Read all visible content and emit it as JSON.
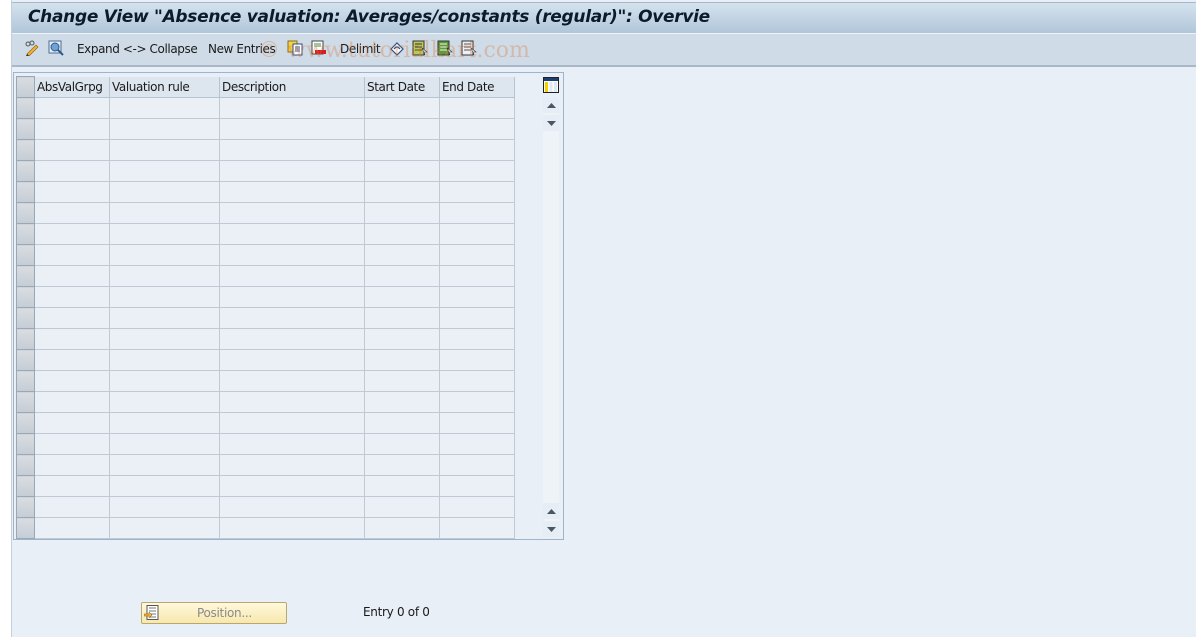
{
  "window": {
    "title": "Change View \"Absence valuation: Averages/constants (regular)\": Overvie"
  },
  "toolbar": {
    "items": [
      {
        "type": "icon",
        "icon": "display-change-icon"
      },
      {
        "type": "icon",
        "icon": "details-icon"
      },
      {
        "type": "text",
        "label": "Expand <-> Collapse"
      },
      {
        "type": "text",
        "label": "New Entries"
      },
      {
        "type": "icon",
        "icon": "copy-as-icon"
      },
      {
        "type": "icon",
        "icon": "delete-icon"
      },
      {
        "type": "text",
        "label": "Delimit"
      },
      {
        "type": "icon",
        "icon": "undo-change-icon"
      },
      {
        "type": "icon",
        "icon": "select-all-icon"
      },
      {
        "type": "icon",
        "icon": "select-block-icon"
      },
      {
        "type": "icon",
        "icon": "deselect-all-icon"
      }
    ],
    "expand_collapse_label": "Expand <-> Collapse",
    "new_entries_label": "New Entries",
    "delimit_label": "Delimit"
  },
  "watermark": "© www.tutorialkart.com",
  "table": {
    "columns": [
      "AbsValGrpg",
      "Valuation rule",
      "Description",
      "Start Date",
      "End Date"
    ],
    "rows": [
      [
        "",
        "",
        "",
        "",
        ""
      ],
      [
        "",
        "",
        "",
        "",
        ""
      ],
      [
        "",
        "",
        "",
        "",
        ""
      ],
      [
        "",
        "",
        "",
        "",
        ""
      ],
      [
        "",
        "",
        "",
        "",
        ""
      ],
      [
        "",
        "",
        "",
        "",
        ""
      ],
      [
        "",
        "",
        "",
        "",
        ""
      ],
      [
        "",
        "",
        "",
        "",
        ""
      ],
      [
        "",
        "",
        "",
        "",
        ""
      ],
      [
        "",
        "",
        "",
        "",
        ""
      ],
      [
        "",
        "",
        "",
        "",
        ""
      ],
      [
        "",
        "",
        "",
        "",
        ""
      ],
      [
        "",
        "",
        "",
        "",
        ""
      ],
      [
        "",
        "",
        "",
        "",
        ""
      ],
      [
        "",
        "",
        "",
        "",
        ""
      ],
      [
        "",
        "",
        "",
        "",
        ""
      ],
      [
        "",
        "",
        "",
        "",
        ""
      ],
      [
        "",
        "",
        "",
        "",
        ""
      ],
      [
        "",
        "",
        "",
        "",
        ""
      ],
      [
        "",
        "",
        "",
        "",
        ""
      ],
      [
        "",
        "",
        "",
        "",
        ""
      ]
    ]
  },
  "footer": {
    "position_button": "Position...",
    "entry_status": "Entry 0 of 0"
  }
}
